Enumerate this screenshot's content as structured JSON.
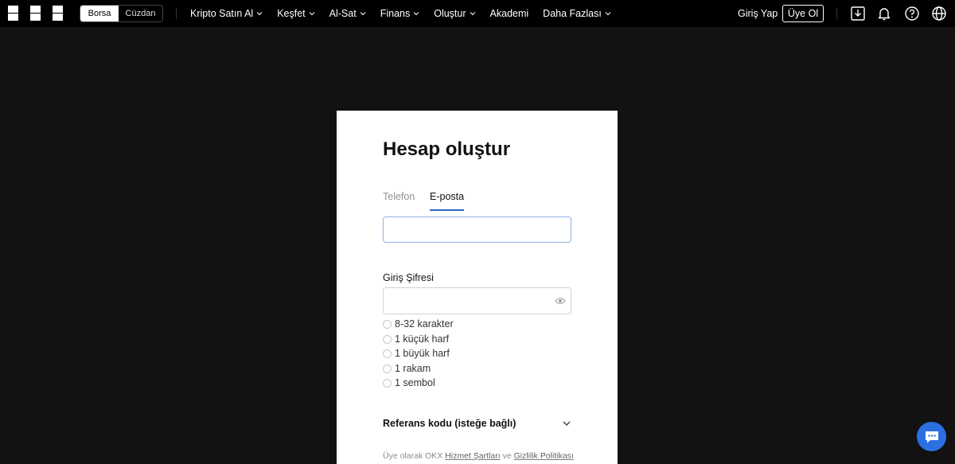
{
  "header": {
    "logo_text": "OKX",
    "switch": {
      "exchange": "Borsa",
      "wallet": "Cüzdan"
    },
    "nav": [
      {
        "label": "Kripto Satın Al",
        "dropdown": true
      },
      {
        "label": "Keşfet",
        "dropdown": true
      },
      {
        "label": "Al-Sat",
        "dropdown": true
      },
      {
        "label": "Finans",
        "dropdown": true
      },
      {
        "label": "Oluştur",
        "dropdown": true
      },
      {
        "label": "Akademi",
        "dropdown": false
      },
      {
        "label": "Daha Fazlası",
        "dropdown": true
      }
    ],
    "login": "Giriş Yap",
    "signup": "Üye Ol",
    "icons": [
      "download-icon",
      "bell-icon",
      "help-icon",
      "globe-icon"
    ]
  },
  "form": {
    "title": "Hesap oluştur",
    "tabs": [
      "Telefon",
      "E-posta"
    ],
    "active_tab": "E-posta",
    "email": {
      "value": "",
      "placeholder": ""
    },
    "password": {
      "label": "Giriş Şifresi",
      "value": "",
      "placeholder": ""
    },
    "requirements": [
      "8-32 karakter",
      "1 küçük harf",
      "1 büyük harf",
      "1 rakam",
      "1 sembol"
    ],
    "referral_label": "Referans kodu (isteğe bağlı)",
    "terms": {
      "prefix": "Üye olarak OKX",
      "tos": "Hizmet Şartları",
      "and": "ve",
      "privacy": "Gizlilik Politikası"
    }
  },
  "colors": {
    "page_bg": "#121212",
    "topbar_bg": "#000000",
    "card_bg": "#ffffff",
    "accent": "#2b67c6",
    "chat_button": "#2b6fe0"
  }
}
